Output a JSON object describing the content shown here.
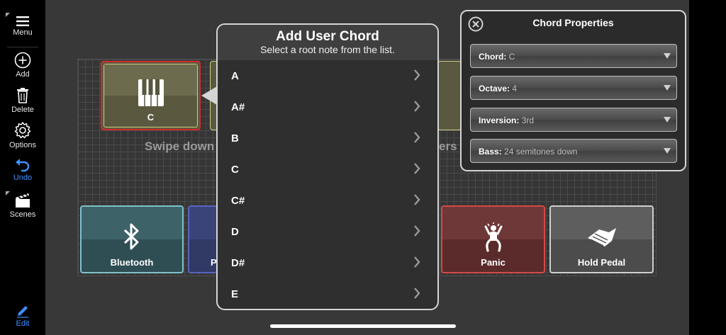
{
  "sidebar": {
    "menu": "Menu",
    "add": "Add",
    "delete": "Delete",
    "options": "Options",
    "undo": "Undo",
    "scenes": "Scenes",
    "edit": "Edit"
  },
  "pads": {
    "top": [
      {
        "label": "C",
        "icon": "piano-keys-icon"
      }
    ],
    "bottom": [
      {
        "label": "Bluetooth",
        "icon": "bluetooth-icon"
      },
      {
        "label": "P",
        "icon": ""
      },
      {
        "label": "Panic",
        "icon": "panic-person-icon"
      },
      {
        "label": "Hold Pedal",
        "icon": "pedal-icon"
      }
    ]
  },
  "swipe_hint": {
    "left": "Swipe down",
    "right": "ers ("
  },
  "popover": {
    "title": "Add User Chord",
    "subtitle": "Select a root note from the list.",
    "notes": [
      "A",
      "A#",
      "B",
      "C",
      "C#",
      "D",
      "D#",
      "E"
    ]
  },
  "properties": {
    "title": "Chord Properties",
    "fields": [
      {
        "key": "Chord:",
        "value": "C"
      },
      {
        "key": "Octave:",
        "value": "4"
      },
      {
        "key": "Inversion:",
        "value": "3rd"
      },
      {
        "key": "Bass:",
        "value": "24 semitones down"
      }
    ]
  },
  "colors": {
    "accent_blue": "#3d8eff",
    "selected_border": "#d62a2a",
    "bluetooth_pad": "#2f4e54",
    "panic_pad": "#5b2b2b"
  }
}
